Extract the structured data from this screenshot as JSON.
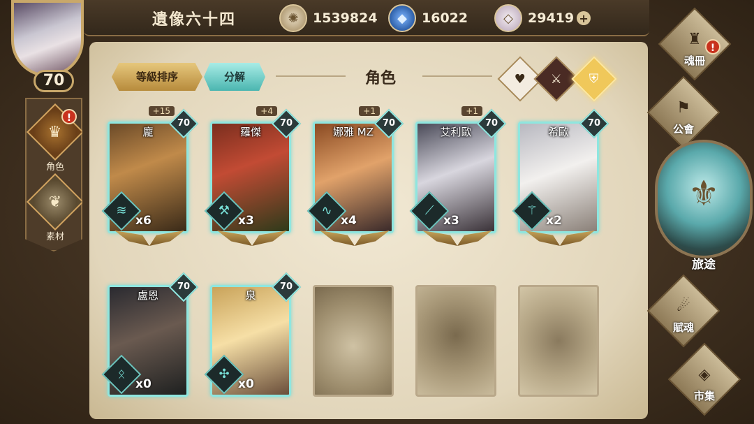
{
  "header": {
    "player_name": "遺像六十四",
    "level": "70",
    "currencies": [
      {
        "icon": "gold-coin-icon",
        "value": "1539824"
      },
      {
        "icon": "blue-crystal-icon",
        "value": "16022"
      },
      {
        "icon": "gem-icon",
        "value": "29419"
      }
    ],
    "plus": "+"
  },
  "leftnav": {
    "items": [
      {
        "label": "角色",
        "icon": "character-icon",
        "alert": "!"
      },
      {
        "label": "素材",
        "icon": "material-icon"
      }
    ]
  },
  "toolbar": {
    "sort_label": "等級排序",
    "decompose_label": "分解",
    "title": "角色"
  },
  "filters": [
    {
      "icon": "heart-icon"
    },
    {
      "icon": "sword-icon"
    },
    {
      "icon": "shield-icon"
    }
  ],
  "cards": [
    {
      "name": "龐",
      "level": "70",
      "plus": "+15",
      "count": "x6",
      "class": "claw-class-icon"
    },
    {
      "name": "羅傑",
      "level": "70",
      "plus": "+4",
      "count": "x3",
      "class": "axe-class-icon"
    },
    {
      "name": "娜雅 MZ",
      "level": "70",
      "plus": "+1",
      "count": "x4",
      "class": "wave-class-icon"
    },
    {
      "name": "艾利歐",
      "level": "70",
      "plus": "+1",
      "count": "x3",
      "class": "blade-class-icon"
    },
    {
      "name": "希歐",
      "level": "70",
      "count": "x2",
      "class": "staff-class-icon"
    },
    {
      "name": "盧恩",
      "level": "70",
      "count": "x0",
      "class": "rune-class-icon"
    },
    {
      "name": "泉",
      "level": "70",
      "count": "x0",
      "class": "wind-class-icon"
    }
  ],
  "rightnav": {
    "items": [
      {
        "label": "魂冊",
        "icon": "soulbook-icon",
        "alert": "!"
      },
      {
        "label": "公會",
        "icon": "guild-icon"
      },
      {
        "label": "賦魂",
        "icon": "soul-infuse-icon"
      },
      {
        "label": "市集",
        "icon": "market-icon"
      }
    ],
    "journey_label": "旅途"
  },
  "colors": {
    "accent_teal": "#8fe6df",
    "gold": "#c9a86a",
    "alert_red": "#c8321e"
  }
}
